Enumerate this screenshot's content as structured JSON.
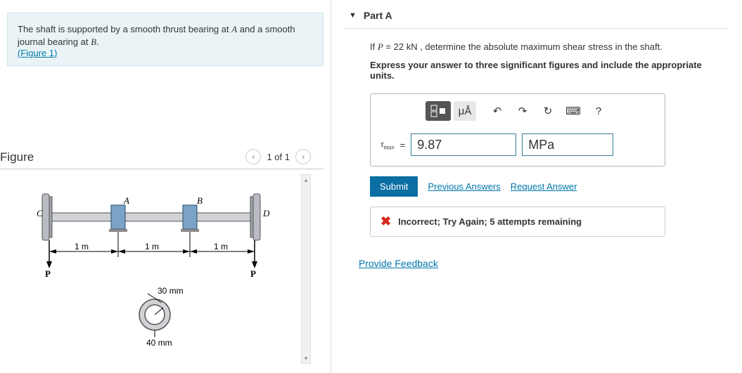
{
  "problem": {
    "text_before": "The shaft is supported by a smooth thrust bearing at ",
    "point_a": "A",
    "text_mid": " and a smooth journal bearing at ",
    "point_b": "B",
    "text_after": ".",
    "figure_link": "(Figure 1)"
  },
  "figure": {
    "title": "Figure",
    "pager": "1 of 1",
    "labels": {
      "C": "C",
      "A": "A",
      "B": "B",
      "D": "D",
      "P1": "P",
      "P2": "P"
    },
    "dims": {
      "d1": "1 m",
      "d2": "1 m",
      "d3": "1 m",
      "ri": "30 mm",
      "ro": "40 mm"
    }
  },
  "part": {
    "label": "Part A",
    "question_prefix": "If ",
    "question_var": "P",
    "question_eq": " = 22 ",
    "question_unit": "kN",
    "question_suffix": " , determine the absolute maximum shear stress in the shaft.",
    "instruction": "Express your answer to three significant figures and include the appropriate units."
  },
  "toolbar": {
    "templates": "□/□",
    "units": "μÅ",
    "undo": "↶",
    "redo": "↷",
    "reset": "↻",
    "keyboard": "⌨",
    "help": "?"
  },
  "answer": {
    "symbol": "τ",
    "subscript": "max",
    "equals": " = ",
    "value": "9.87",
    "unit": "MPa"
  },
  "actions": {
    "submit": "Submit",
    "previous": "Previous Answers",
    "request": "Request Answer"
  },
  "feedback": {
    "text": "Incorrect; Try Again; 5 attempts remaining"
  },
  "footer": {
    "provide": "Provide Feedback"
  }
}
